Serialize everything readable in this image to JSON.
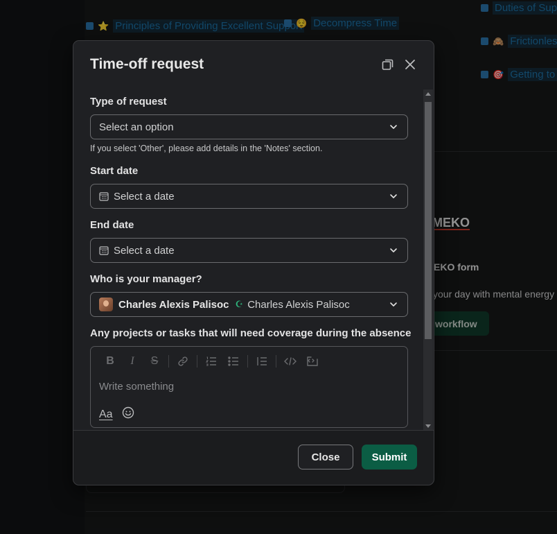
{
  "background": {
    "links": [
      {
        "text": "Principles of Providing Excellent Support",
        "emoji": "⭐"
      },
      {
        "text": "Decompress Time",
        "emoji": "😌"
      },
      {
        "text": "Duties of Sup",
        "emoji": ""
      },
      {
        "text": "Frictionless",
        "emoji": "🙈"
      },
      {
        "text": "Getting to",
        "emoji": "🎯"
      }
    ],
    "heading_partial": "MEKO",
    "form_label_partial": "EKO form",
    "description_partial": "your day with mental energy",
    "workflow_button_partial": "workflow"
  },
  "modal": {
    "title": "Time-off request",
    "fields": {
      "type": {
        "label": "Type of request",
        "value": "Select an option",
        "hint": "If you select 'Other', please add details in the 'Notes' section."
      },
      "start": {
        "label": "Start date",
        "value": "Select a date"
      },
      "end": {
        "label": "End date",
        "value": "Select a date"
      },
      "manager": {
        "label": "Who is your manager?",
        "name_bold": "Charles Alexis Palisoc",
        "name": "Charles Alexis Palisoc"
      },
      "coverage": {
        "label": "Any projects or tasks that will need coverage during the absence",
        "placeholder": "Write something",
        "format_label": "Aa"
      }
    },
    "buttons": {
      "close": "Close",
      "submit": "Submit"
    }
  },
  "colors": {
    "accent": "#0b5d44",
    "link": "#1d6fa3",
    "modal_bg": "#1f2023"
  }
}
